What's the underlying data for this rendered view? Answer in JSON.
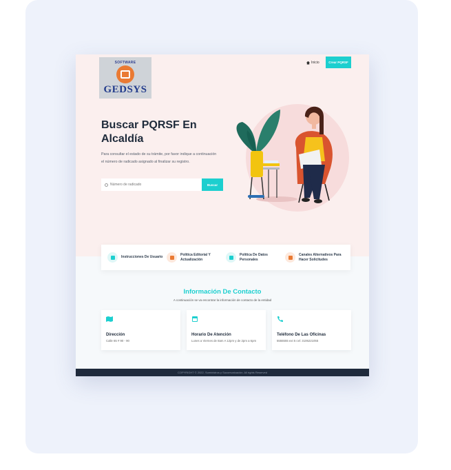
{
  "logo": {
    "top_text": "SOFTWARE",
    "text": "GEDSYS"
  },
  "nav": {
    "home_label": "Inicio",
    "create_button": "Crear PQRSF"
  },
  "hero": {
    "title": "Buscar PQRSF En Alcaldía",
    "description": "Para consultar el estado de su trámite, por favor indique a continuación el número de radicado asignado al finalizar su registro.",
    "search_placeholder": "Número de radicado",
    "search_button": "Buscar"
  },
  "quick_links": [
    {
      "label": "Instrucciones De Usuario",
      "icon": "info-icon",
      "color": "#1ccfcf",
      "bg": "#dff7f7"
    },
    {
      "label": "Política Editorial Y Actualización",
      "icon": "document-icon",
      "color": "#ea7a33",
      "bg": "#fde9dd"
    },
    {
      "label": "Política De Datos Personales",
      "icon": "id-card-icon",
      "color": "#1ccfcf",
      "bg": "#dff7f7"
    },
    {
      "label": "Canales Alternativos Para Hacer Solicitudes",
      "icon": "channels-icon",
      "color": "#ea7a33",
      "bg": "#fde9dd"
    }
  ],
  "contact": {
    "title": "Información De Contacto",
    "subtitle": "A continuación se va encontrar la información de contacto de la entidad",
    "cards": [
      {
        "title": "Dirección",
        "text": "Calle 65 # 90 - 90",
        "icon": "map-icon"
      },
      {
        "title": "Horario De Atención",
        "text": "Lunes a Viernes de 8am A 12pm y de 2pm a 6pm",
        "icon": "calendar-icon"
      },
      {
        "title": "Teléfono De Las Oficinas",
        "text": "5555555 ext 5 cel: 3106221055",
        "icon": "phone-icon"
      }
    ]
  },
  "footer": {
    "text": "COPYRIGHT © 2022, Suministros y Sucomunicación. All rights Reserved"
  },
  "colors": {
    "accent": "#1ccfcf",
    "orange": "#ea7a33",
    "hero_bg": "#fbefee",
    "footer_bg": "#1f2a3c"
  }
}
